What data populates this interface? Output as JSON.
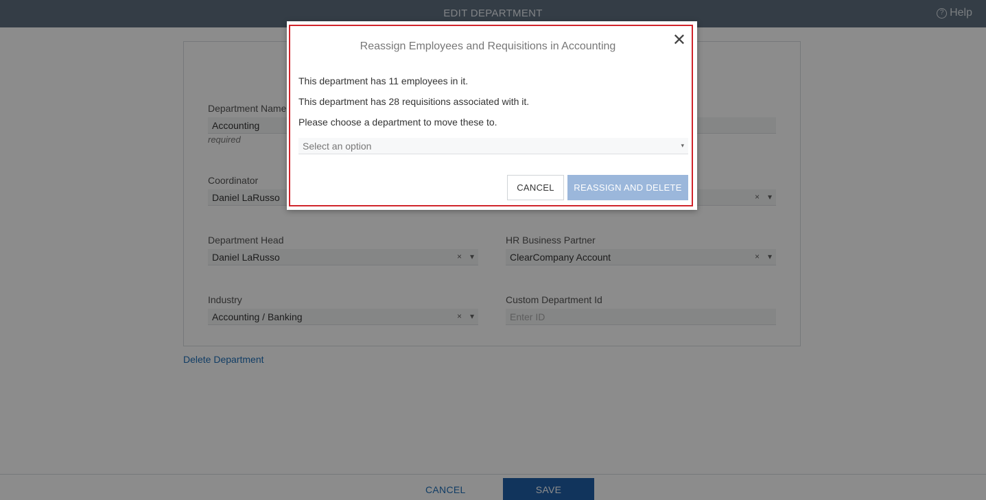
{
  "header": {
    "title": "EDIT DEPARTMENT",
    "help_label": "Help",
    "help_icon": "question-circle-icon"
  },
  "form": {
    "department_name_label": "Department Name",
    "department_name_value": "Accounting",
    "required_label": "required",
    "coordinator_label": "Coordinator",
    "coordinator_value": "Daniel LaRusso",
    "department_head_label": "Department Head",
    "department_head_value": "Daniel LaRusso",
    "hr_partner_label": "HR Business Partner",
    "hr_partner_value": "ClearCompany Account",
    "industry_label": "Industry",
    "industry_value": "Accounting / Banking",
    "custom_id_label": "Custom Department Id",
    "custom_id_placeholder": "Enter ID",
    "clear_glyph": "×",
    "dropdown_glyph": "▾"
  },
  "delete_link": "Delete Department",
  "footer": {
    "cancel_label": "CANCEL",
    "save_label": "SAVE"
  },
  "modal": {
    "title": "Reassign Employees and Requisitions in Accounting",
    "close_glyph": "✕",
    "line1": "This department has 11 employees in it.",
    "line2": "This department has 28 requisitions associated with it.",
    "line3": "Please choose a department to move these to.",
    "select_placeholder": "Select an option",
    "cancel_label": "CANCEL",
    "reassign_label": "REASSIGN AND DELETE"
  },
  "colors": {
    "topbar": "#5f6f80",
    "link": "#1f6fb8",
    "save": "#1f5fa8",
    "reassign": "#9bb7db",
    "highlight": "#d0232a"
  }
}
